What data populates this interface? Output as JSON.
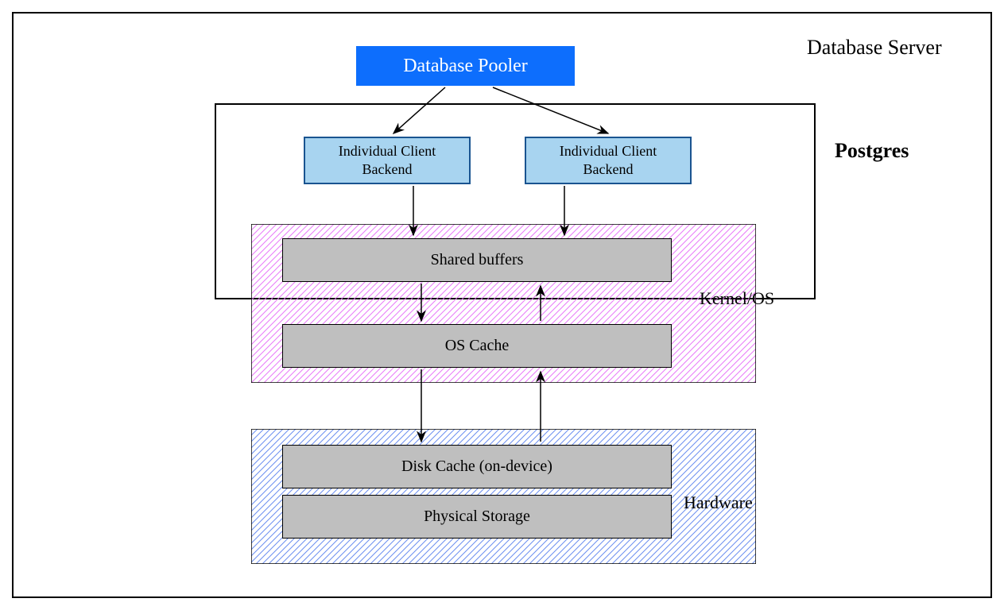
{
  "title": "Database Server",
  "pooler": "Database Pooler",
  "postgres_label": "Postgres",
  "client1": "Individual Client\nBackend",
  "client2": "Individual Client\nBackend",
  "kernel_label": "Kernel/OS",
  "shared_buffers": "Shared buffers",
  "os_cache": "OS Cache",
  "hardware_label": "Hardware",
  "disk_cache": "Disk Cache (on-device)",
  "physical_storage": "Physical Storage",
  "colors": {
    "pooler_bg": "#0d6efd",
    "client_bg": "#a8d4f0",
    "kernel_hatch": "#d946ef",
    "hardware_hatch": "#3b5be0",
    "gray_box": "#bfbfbf"
  }
}
